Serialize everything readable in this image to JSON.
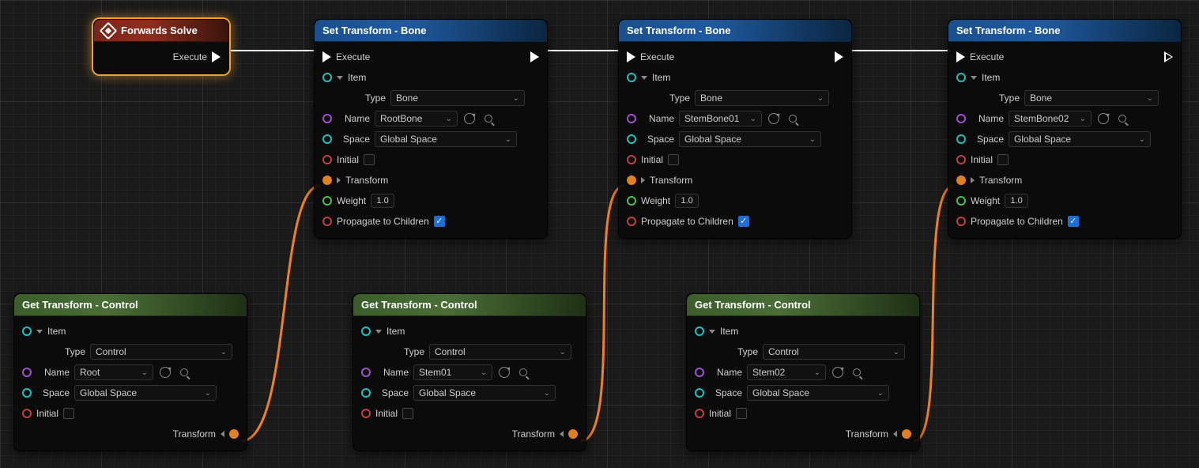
{
  "forwards_solve": {
    "title": "Forwards Solve",
    "execute": "Execute"
  },
  "set_transform_bone": {
    "title": "Set Transform - Bone",
    "execute": "Execute",
    "item": "Item",
    "type_label": "Type",
    "type_value": "Bone",
    "name_label": "Name",
    "space_label": "Space",
    "space_value": "Global Space",
    "initial": "Initial",
    "transform": "Transform",
    "weight_label": "Weight",
    "weight_value": "1.0",
    "propagate": "Propagate to Children"
  },
  "set_nodes": [
    {
      "name_value": "RootBone"
    },
    {
      "name_value": "StemBone01"
    },
    {
      "name_value": "StemBone02"
    }
  ],
  "get_transform_control": {
    "title": "Get Transform - Control",
    "item": "Item",
    "type_label": "Type",
    "type_value": "Control",
    "name_label": "Name",
    "space_label": "Space",
    "space_value": "Global Space",
    "initial": "Initial",
    "transform_out": "Transform"
  },
  "get_nodes": [
    {
      "name_value": "Root"
    },
    {
      "name_value": "Stem01"
    },
    {
      "name_value": "Stem02"
    }
  ],
  "positions": {
    "forwards": [
      118,
      24,
      172,
      54
    ],
    "set": [
      [
        397,
        24,
        296,
        280
      ],
      [
        782,
        24,
        296,
        280
      ],
      [
        1199,
        24,
        296,
        280
      ]
    ],
    "get": [
      [
        17,
        371,
        296,
        200
      ],
      [
        446,
        371,
        296,
        200
      ],
      [
        868,
        371,
        296,
        200
      ]
    ]
  }
}
